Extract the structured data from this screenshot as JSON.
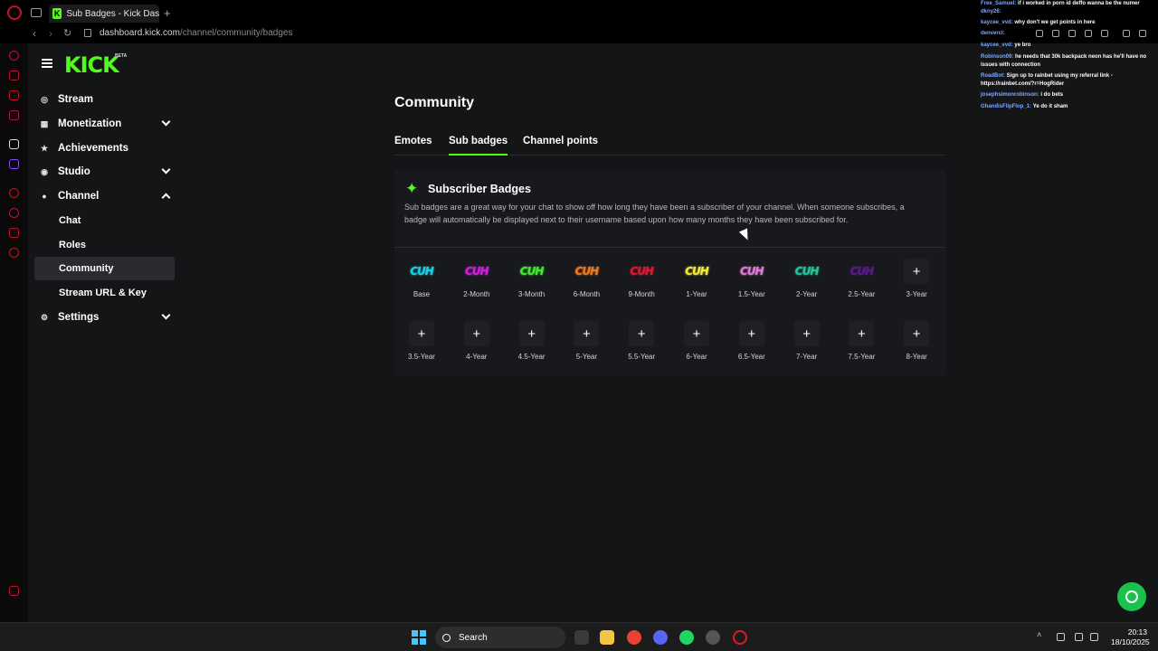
{
  "browser": {
    "tab_title": "Sub Badges - Kick Dashbo",
    "favicon_letter": "K",
    "new_tab": "+",
    "url_domain": "dashboard.kick.com",
    "url_path": "/channel/community/badges"
  },
  "brand": {
    "logo": "KICK",
    "beta": "BETA",
    "accent_color": "#53fc18"
  },
  "nav": {
    "stream": "Stream",
    "monetization": "Monetization",
    "achievements": "Achievements",
    "studio": "Studio",
    "channel": "Channel",
    "chat": "Chat",
    "roles": "Roles",
    "community": "Community",
    "stream_url_key": "Stream URL & Key",
    "settings": "Settings"
  },
  "page": {
    "title": "Community",
    "tabs": [
      "Emotes",
      "Sub badges",
      "Channel points"
    ],
    "active_tab": "Sub badges"
  },
  "panel": {
    "title": "Subscriber Badges",
    "description": "Sub badges are a great way for your chat to show off how long they have been a subscriber of your channel. When someone subscribes, a badge will automatically be displayed next to their username based upon how many months they have been subscribed for."
  },
  "badges": [
    {
      "label": "Base",
      "set": true,
      "text": "CUH",
      "color": "#19d3e6"
    },
    {
      "label": "2-Month",
      "set": true,
      "text": "CUH",
      "color": "#d21ee0"
    },
    {
      "label": "3-Month",
      "set": true,
      "text": "CUH",
      "color": "#3bf22a"
    },
    {
      "label": "6-Month",
      "set": true,
      "text": "CUH",
      "color": "#f07b1f"
    },
    {
      "label": "9-Month",
      "set": true,
      "text": "CUH",
      "color": "#e0182d"
    },
    {
      "label": "1-Year",
      "set": true,
      "text": "CUH",
      "color": "#f2ec3a"
    },
    {
      "label": "1.5-Year",
      "set": true,
      "text": "CUH",
      "color": "#e07ad8"
    },
    {
      "label": "2-Year",
      "set": true,
      "text": "CUH",
      "color": "#21c79a"
    },
    {
      "label": "2.5-Year",
      "set": true,
      "text": "CUH",
      "color": "#5b1a8a"
    },
    {
      "label": "3-Year",
      "set": false,
      "text": "+",
      "color": "#ffffff"
    },
    {
      "label": "3.5-Year",
      "set": false,
      "text": "+",
      "color": "#ffffff"
    },
    {
      "label": "4-Year",
      "set": false,
      "text": "+",
      "color": "#ffffff"
    },
    {
      "label": "4.5-Year",
      "set": false,
      "text": "+",
      "color": "#ffffff"
    },
    {
      "label": "5-Year",
      "set": false,
      "text": "+",
      "color": "#ffffff"
    },
    {
      "label": "5.5-Year",
      "set": false,
      "text": "+",
      "color": "#ffffff"
    },
    {
      "label": "6-Year",
      "set": false,
      "text": "+",
      "color": "#ffffff"
    },
    {
      "label": "6.5-Year",
      "set": false,
      "text": "+",
      "color": "#ffffff"
    },
    {
      "label": "7-Year",
      "set": false,
      "text": "+",
      "color": "#ffffff"
    },
    {
      "label": "7.5-Year",
      "set": false,
      "text": "+",
      "color": "#ffffff"
    },
    {
      "label": "8-Year",
      "set": false,
      "text": "+",
      "color": "#ffffff"
    }
  ],
  "chat": [
    {
      "user": "Free_Samuel:",
      "msg": "if i worked in porn id deffo wanna be the numer"
    },
    {
      "user": "dkny26:",
      "msg": ""
    },
    {
      "user": "kaycee_vvd:",
      "msg": "why don't we get points in here"
    },
    {
      "user": "denvercl:",
      "msg": ""
    },
    {
      "user": "kaycee_vvd:",
      "msg": "ye bro"
    },
    {
      "user": "Robinson09:",
      "msg": "he needs that 30k backpack neon has he'll have no issues with connection"
    },
    {
      "user": "RoadBot:",
      "msg": "Sign up to rainbet using my referral link - https://rainbet.com/?r=HogRider"
    },
    {
      "user": "josephsimonrobinson:",
      "msg": "i do bets"
    },
    {
      "user": "GhandisFlipFlop_1:",
      "msg": "Ye do it sham"
    }
  ],
  "taskbar": {
    "search_label": "Search",
    "time": "20:13",
    "date": "18/10/2025"
  }
}
